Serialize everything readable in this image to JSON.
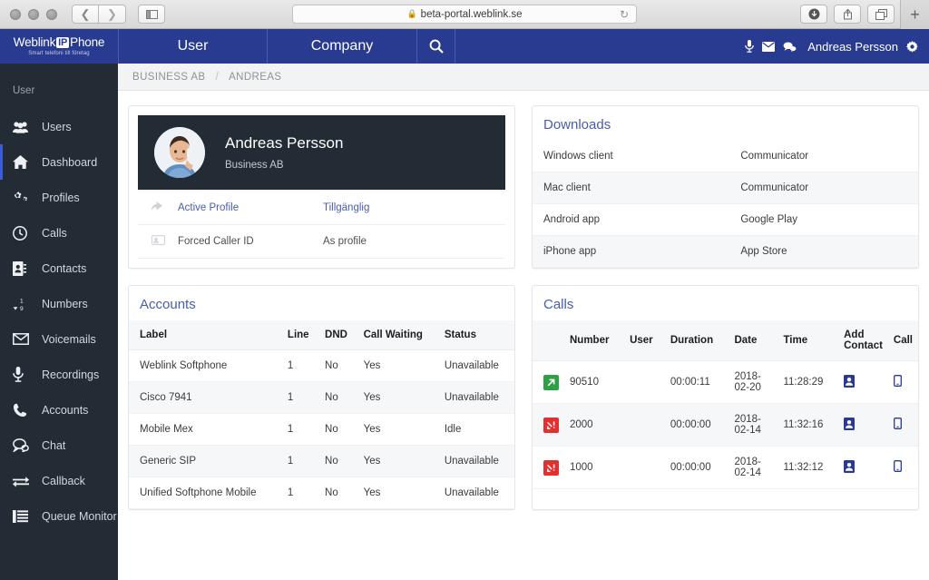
{
  "browser": {
    "url": "beta-portal.weblink.se",
    "lock_icon": "lock-icon",
    "reload_icon": "reload-icon",
    "back_icon": "back-chevron-icon",
    "forward_icon": "forward-chevron-icon",
    "sidebar_icon": "sidebar-toggle-icon",
    "download_icon": "download-icon",
    "share_icon": "share-icon",
    "tabs_icon": "show-tabs-icon",
    "newtab_label": "+"
  },
  "brand": {
    "word1": "Weblink",
    "badge": "IP",
    "word2": "Phone",
    "tagline": "Smart telefoni till företag"
  },
  "topnav": {
    "tabs": [
      {
        "label": "User",
        "name": "tab-user"
      },
      {
        "label": "Company",
        "name": "tab-company"
      }
    ],
    "search_icon": "search-icon",
    "icons": [
      {
        "name": "microphone-icon"
      },
      {
        "name": "envelope-icon"
      },
      {
        "name": "chat-bubbles-icon"
      }
    ],
    "user": "Andreas Persson",
    "gear_icon": "gear-icon"
  },
  "breadcrumb": {
    "items": [
      "BUSINESS AB",
      "ANDREAS"
    ],
    "separator": "/"
  },
  "sidebar": {
    "section_label": "User",
    "items": [
      {
        "label": "Users",
        "icon": "users-icon",
        "active": false
      },
      {
        "label": "Dashboard",
        "icon": "home-icon",
        "active": true
      },
      {
        "label": "Profiles",
        "icon": "gears-icon",
        "active": false
      },
      {
        "label": "Calls",
        "icon": "clock-icon",
        "active": false
      },
      {
        "label": "Contacts",
        "icon": "address-book-icon",
        "active": false
      },
      {
        "label": "Numbers",
        "icon": "sort-numeric-icon",
        "active": false
      },
      {
        "label": "Voicemails",
        "icon": "envelope-icon",
        "active": false
      },
      {
        "label": "Recordings",
        "icon": "microphone-icon",
        "active": false
      },
      {
        "label": "Accounts",
        "icon": "phone-icon",
        "active": false
      },
      {
        "label": "Chat",
        "icon": "chat-bubbles-icon",
        "active": false
      },
      {
        "label": "Callback",
        "icon": "exchange-arrows-icon",
        "active": false
      },
      {
        "label": "Queue Monitor",
        "icon": "list-icon",
        "active": false
      }
    ]
  },
  "profile_card": {
    "name": "Andreas Persson",
    "organization": "Business AB",
    "avatar_icon": "user-photo-avatar",
    "rows": [
      {
        "icon": "reply-arrow-icon",
        "key": "Active Profile",
        "key_link": true,
        "value": "Tillgänglig",
        "value_link": true
      },
      {
        "icon": "id-card-icon",
        "key": "Forced Caller ID",
        "key_link": false,
        "value": "As profile",
        "value_link": false
      }
    ]
  },
  "downloads": {
    "title": "Downloads",
    "rows": [
      {
        "platform": "Windows client",
        "link": "Communicator"
      },
      {
        "platform": "Mac client",
        "link": "Communicator"
      },
      {
        "platform": "Android app",
        "link": "Google Play"
      },
      {
        "platform": "iPhone app",
        "link": "App Store"
      }
    ]
  },
  "accounts": {
    "title": "Accounts",
    "headers": [
      "Label",
      "Line",
      "DND",
      "Call Waiting",
      "Status"
    ],
    "rows": [
      {
        "label": "Weblink Softphone",
        "line": "1",
        "dnd": "No",
        "call_waiting": "Yes",
        "status": "Unavailable",
        "status_kind": "unavailable"
      },
      {
        "label": "Cisco 7941",
        "line": "1",
        "dnd": "No",
        "call_waiting": "Yes",
        "status": "Unavailable",
        "status_kind": "unavailable"
      },
      {
        "label": "Mobile Mex",
        "line": "1",
        "dnd": "No",
        "call_waiting": "Yes",
        "status": "Idle",
        "status_kind": "idle"
      },
      {
        "label": "Generic SIP",
        "line": "1",
        "dnd": "No",
        "call_waiting": "Yes",
        "status": "Unavailable",
        "status_kind": "unavailable"
      },
      {
        "label": "Unified Softphone Mobile",
        "line": "1",
        "dnd": "No",
        "call_waiting": "Yes",
        "status": "Unavailable",
        "status_kind": "unavailable"
      }
    ]
  },
  "calls": {
    "title": "Calls",
    "headers": [
      "",
      "Number",
      "User",
      "Duration",
      "Date",
      "Time",
      "Add Contact",
      "Call"
    ],
    "rows": [
      {
        "type": "outgoing",
        "type_icon": "outgoing-call-icon",
        "number": "90510",
        "user": "",
        "duration": "00:00:11",
        "date": "2018-02-20",
        "time": "11:28:29",
        "add_contact_icon": "add-contact-icon",
        "call_icon": "mobile-phone-icon"
      },
      {
        "type": "missed",
        "type_icon": "missed-call-icon",
        "number": "2000",
        "user": "",
        "duration": "00:00:00",
        "date": "2018-02-14",
        "time": "11:32:16",
        "add_contact_icon": "add-contact-icon",
        "call_icon": "mobile-phone-icon"
      },
      {
        "type": "missed",
        "type_icon": "missed-call-icon",
        "number": "1000",
        "user": "",
        "duration": "00:00:00",
        "date": "2018-02-14",
        "time": "11:32:12",
        "add_contact_icon": "add-contact-icon",
        "call_icon": "mobile-phone-icon"
      }
    ]
  },
  "colors": {
    "brand_blue": "#283b91",
    "sidebar_dark": "#232c35",
    "accent_bar": "#3b5bdb",
    "link": "#4a5cae",
    "status_unavailable": "#e8404a",
    "status_idle": "#2e9e4e",
    "call_outgoing": "#2f9e44",
    "call_missed": "#e03131"
  }
}
